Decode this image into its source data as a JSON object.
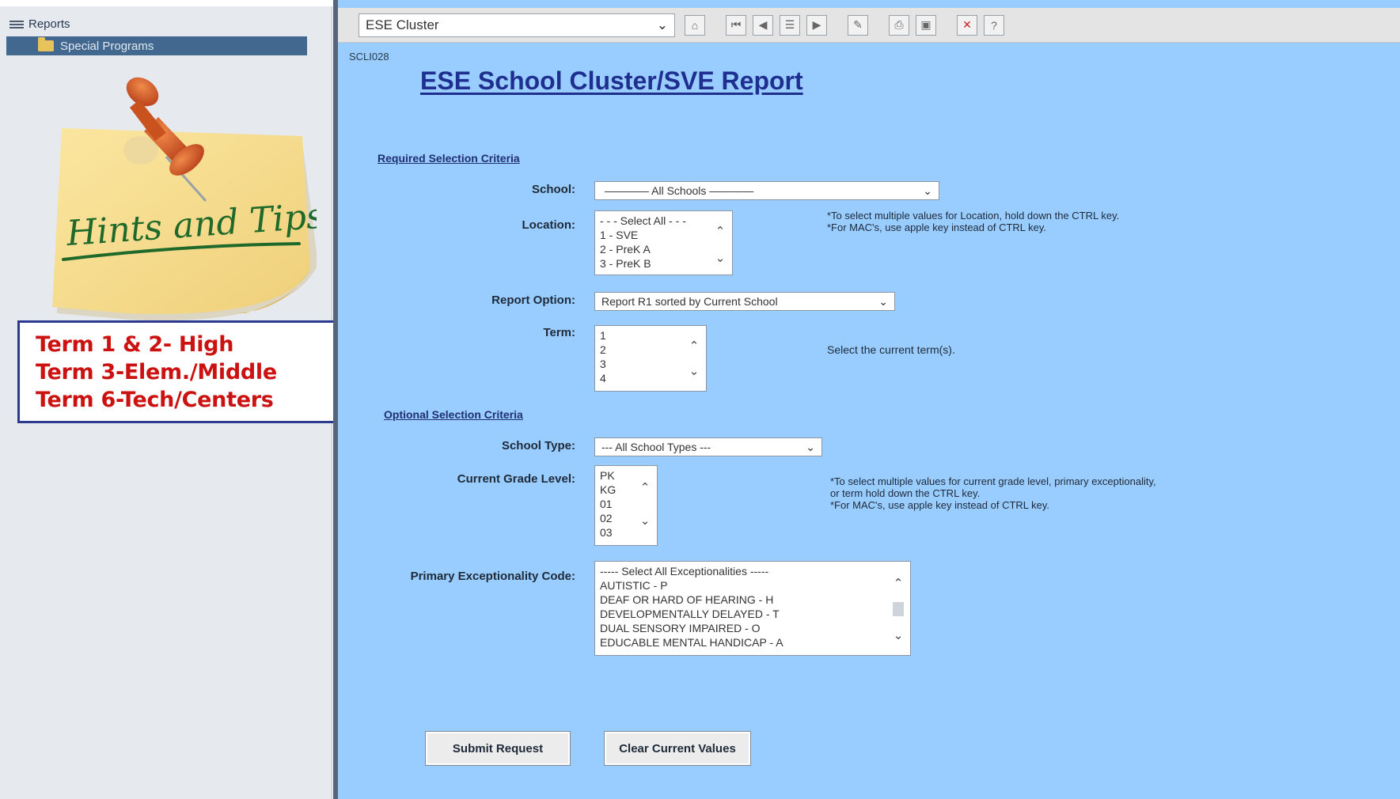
{
  "sidebar": {
    "root_label": "Reports",
    "selected_label": "Special Programs"
  },
  "hints_note": {
    "text": "Hints and Tips"
  },
  "callout": {
    "lines": [
      "Term 1 & 2- High",
      "Term 3-Elem./Middle",
      "Term 6-Tech/Centers"
    ]
  },
  "toolbar": {
    "report_select_value": "ESE Cluster",
    "buttons": [
      "home-icon",
      "first-record-icon",
      "previous-record-icon",
      "next-record-icon",
      "last-record-icon",
      "edit-icon",
      "print-icon",
      "save-icon",
      "close-icon",
      "help-icon"
    ]
  },
  "form": {
    "id": "SCLI028",
    "title": "ESE School Cluster/SVE Report",
    "required_section": "Required Selection Criteria",
    "optional_section": "Optional Selection Criteria",
    "school": {
      "label": "School:",
      "value": "———— All Schools ————"
    },
    "location": {
      "label": "Location:",
      "options": [
        "- - - Select All - - -",
        "1 - SVE",
        "2 - PreK A",
        "3 - PreK B"
      ],
      "hint": "*To select multiple values for Location, hold down the CTRL key.\n*For MAC's, use apple key instead of CTRL key."
    },
    "report_option": {
      "label": "Report Option:",
      "value": "Report R1 sorted by Current School"
    },
    "term": {
      "label": "Term:",
      "options": [
        "1",
        "2",
        "3",
        "4"
      ],
      "hint": "Select the current term(s)."
    },
    "school_type": {
      "label": "School Type:",
      "value": "--- All School Types ---"
    },
    "grade_level": {
      "label": "Current Grade Level:",
      "options": [
        "PK",
        "KG",
        "01",
        "02",
        "03"
      ],
      "hint": "*To select multiple values for current grade level, primary exceptionality, or term hold down the CTRL key.\n*For MAC's, use apple key instead of CTRL key."
    },
    "exceptionality": {
      "label": "Primary Exceptionality Code:",
      "options": [
        "----- Select All Exceptionalities -----",
        "AUTISTIC - P",
        "DEAF OR HARD OF HEARING - H",
        "DEVELOPMENTALLY DELAYED - T",
        "DUAL SENSORY IMPAIRED - O",
        "EDUCABLE MENTAL HANDICAP - A"
      ]
    },
    "submit_label": "Submit Request",
    "clear_label": "Clear Current Values"
  },
  "colors": {
    "main_background": "#99ccff",
    "title": "#1f2f8f",
    "callout_text": "#cc1111",
    "callout_border": "#2b3a8f",
    "sidebar_selected": "#43688f"
  }
}
